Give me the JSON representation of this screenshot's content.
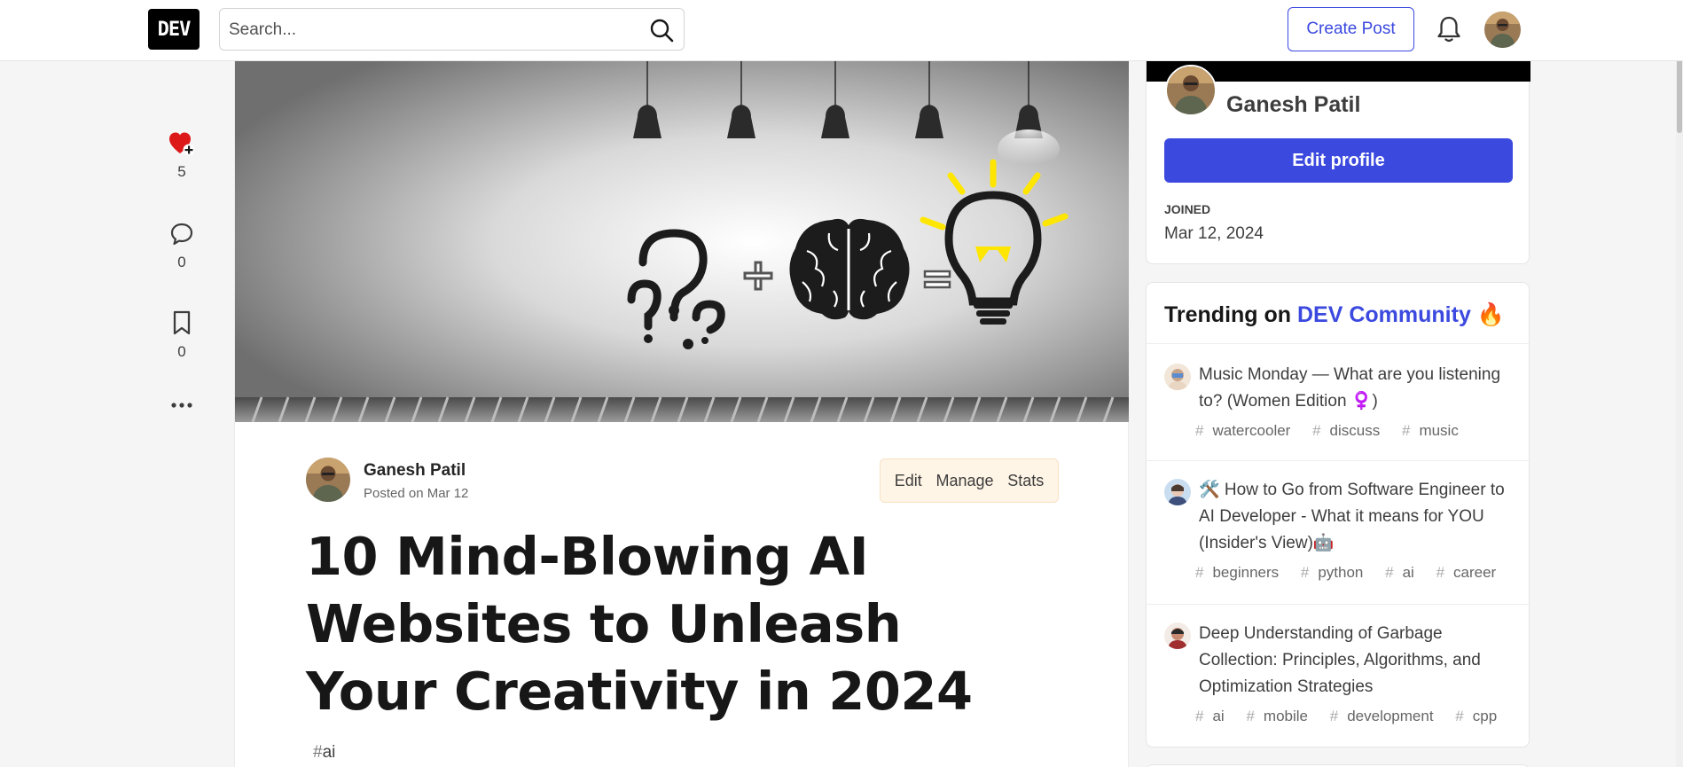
{
  "header": {
    "logo_text": "DEV",
    "search_placeholder": "Search...",
    "create_post_label": "Create Post"
  },
  "rail": {
    "reactions_count": "5",
    "comments_count": "0",
    "bookmarks_count": "0"
  },
  "article": {
    "author_name": "Ganesh Patil",
    "posted": "Posted on Mar 12",
    "actions": [
      "Edit",
      "Manage",
      "Stats"
    ],
    "title": "10 Mind-Blowing AI Websites to Unleash Your Creativity in 2024",
    "tags": [
      {
        "hash": "#",
        "name": "ai"
      }
    ]
  },
  "profile": {
    "name": "Ganesh Patil",
    "edit_label": "Edit profile",
    "joined_label": "JOINED",
    "joined_date": "Mar 12, 2024"
  },
  "trending": {
    "prefix": "Trending on ",
    "community": "DEV Community",
    "emoji": "🔥",
    "items": [
      {
        "title": "Music Monday — What are you listening to? (Women Edition ♀️)",
        "tags": [
          "watercooler",
          "discuss",
          "music"
        ]
      },
      {
        "title": "🛠️ How to Go from Software Engineer to AI Developer - What it means for YOU (Insider's View)🤖",
        "tags": [
          "beginners",
          "python",
          "ai",
          "career"
        ]
      },
      {
        "title": "Deep Understanding of Garbage Collection: Principles, Algorithms, and Optimization Strategies",
        "tags": [
          "ai",
          "mobile",
          "development",
          "cpp"
        ]
      }
    ]
  },
  "colors": {
    "accent": "#3b49df",
    "heart": "#dc1818",
    "bulb": "#ffe600"
  }
}
